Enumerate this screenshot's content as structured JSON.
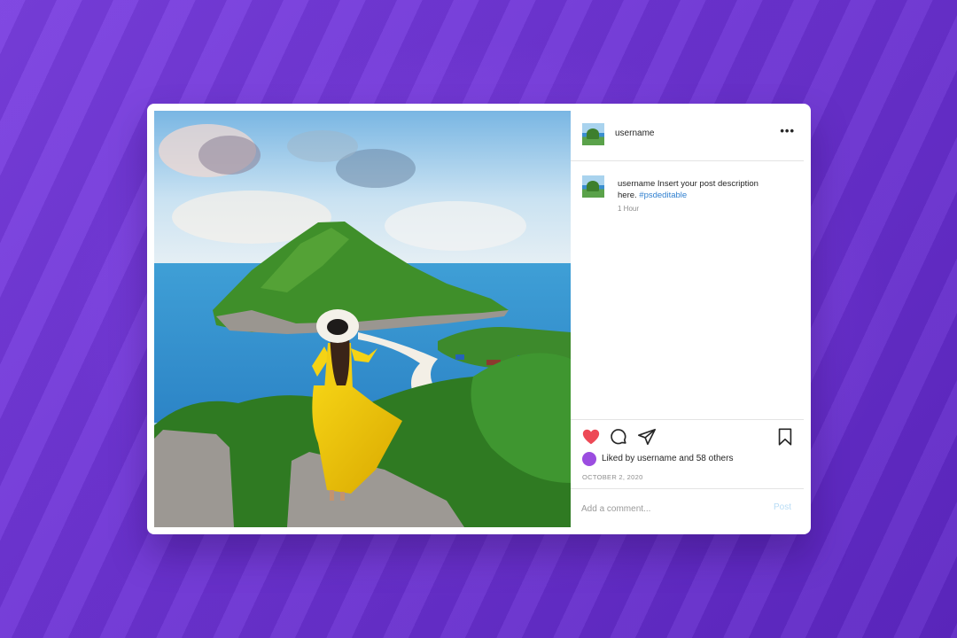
{
  "post": {
    "username": "username",
    "more_icon": "more-horizontal-icon",
    "caption": {
      "username": "username",
      "text": "Insert your post description here.",
      "hashtag": "#psdeditable",
      "time": "1 Hour"
    },
    "actions": {
      "like_icon": "heart-icon",
      "like_color": "#ed4956",
      "comment_icon": "comment-icon",
      "share_icon": "share-icon",
      "save_icon": "bookmark-icon"
    },
    "likes": {
      "prefix": "Liked by",
      "username": "username",
      "suffix": "and 58 others"
    },
    "date": "OCTOBER 2, 2020",
    "comment": {
      "placeholder": "Add a comment...",
      "value": "",
      "post_label": "Post"
    }
  },
  "colors": {
    "background": "#6d33d4",
    "card": "#ffffff",
    "hashtag": "#2f7fcf",
    "post_button": "#b8dcf5",
    "liked_avatar": "#9b4de0"
  }
}
